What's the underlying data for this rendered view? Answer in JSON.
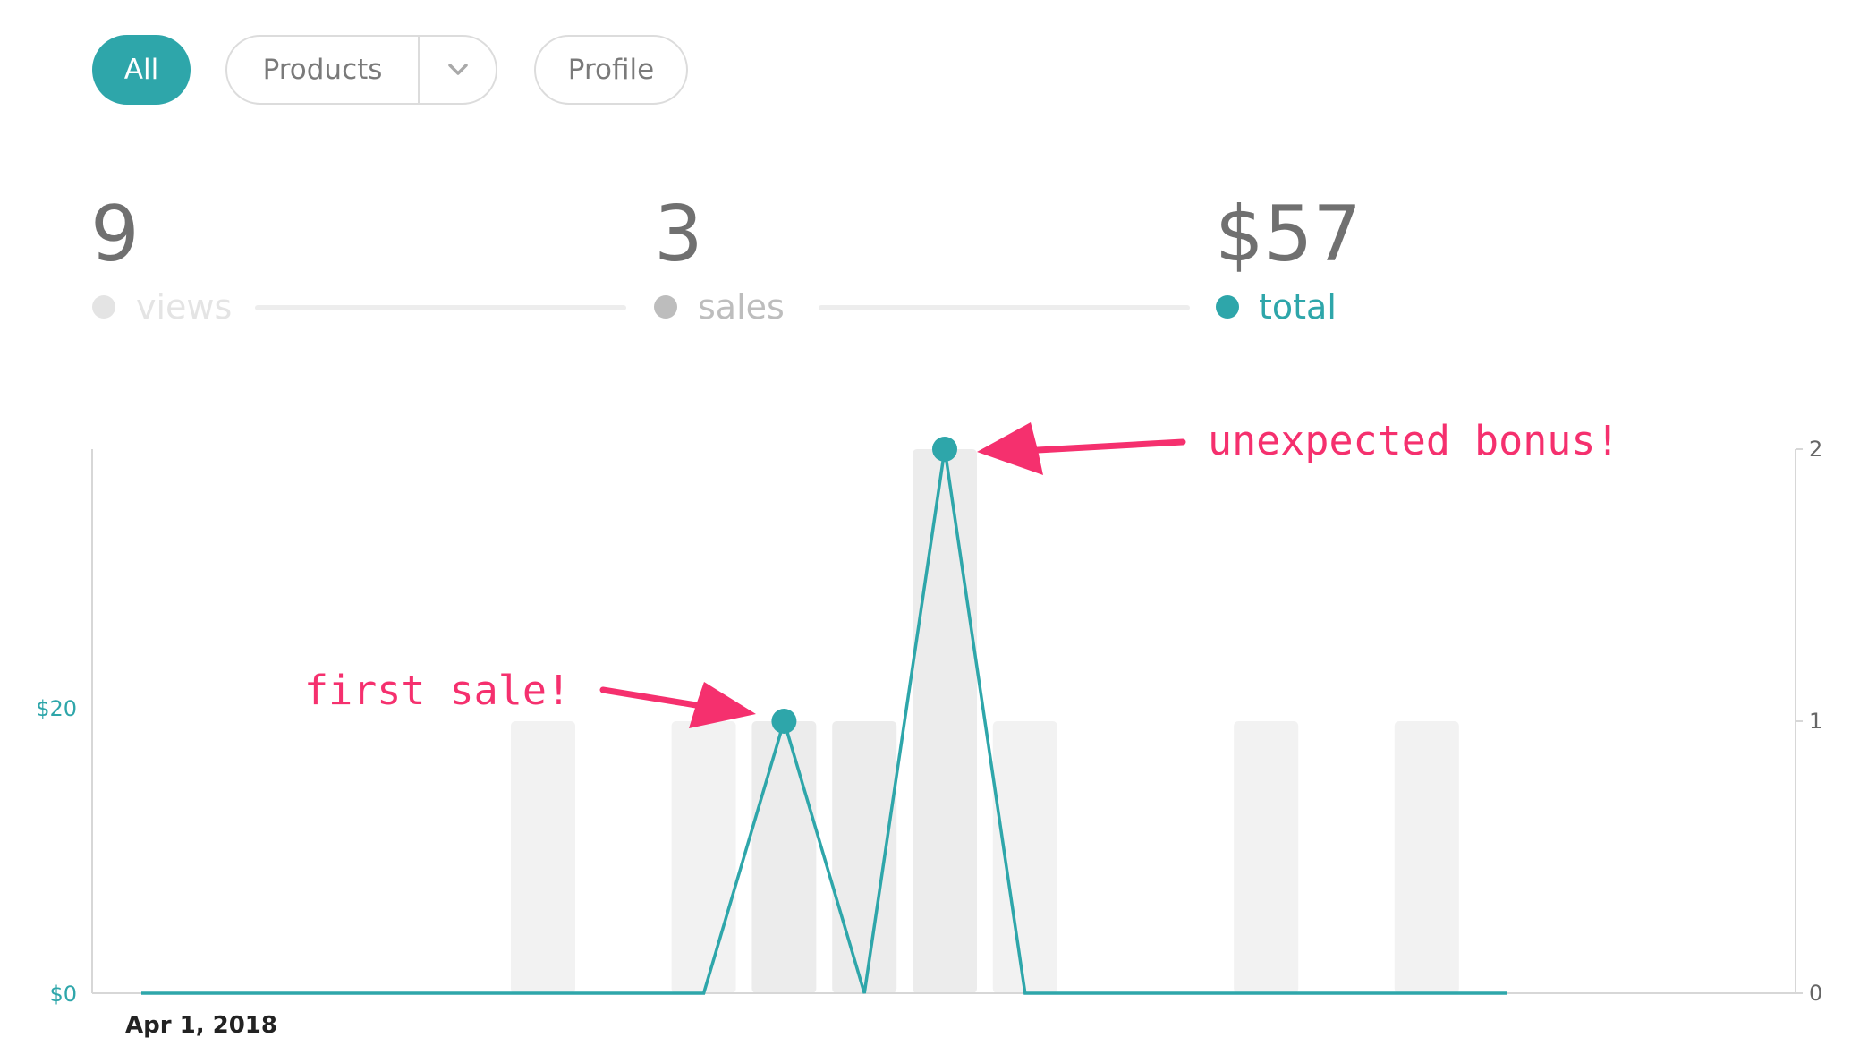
{
  "filters": {
    "all_label": "All",
    "products_label": "Products",
    "profile_label": "Profile"
  },
  "stats": {
    "views": {
      "value": "9",
      "label": "views",
      "color": "#e4e4e4"
    },
    "sales": {
      "value": "3",
      "label": "sales",
      "color": "#bdbdbd"
    },
    "total": {
      "value": "$57",
      "label": "total",
      "color": "#2ea6aa"
    }
  },
  "colors": {
    "accent": "#2ea6aa",
    "annotation": "#f5306e",
    "bar": "#f2f2f2",
    "bar_highlight": "#ececec"
  },
  "annotations": {
    "first_sale": "first sale!",
    "unexpected_bonus": "unexpected bonus!"
  },
  "chart_data": {
    "type": "bar",
    "x_start_label": "Apr 1, 2018",
    "left_axis": {
      "tick_labels": [
        "$0",
        "$20"
      ]
    },
    "right_axis": {
      "tick_labels": [
        "0",
        "1",
        "2"
      ],
      "ylim": [
        0,
        2
      ]
    },
    "series": [
      {
        "name": "sales",
        "kind": "bar",
        "axis": "right",
        "values": [
          0,
          0,
          0,
          0,
          0,
          1,
          0,
          1,
          1,
          1,
          2,
          1,
          0,
          0,
          1,
          0,
          1,
          0,
          0,
          0,
          0
        ]
      },
      {
        "name": "total",
        "kind": "line",
        "axis": "right",
        "values": [
          0,
          0,
          0,
          0,
          0,
          0,
          0,
          0,
          1,
          0,
          2,
          0,
          0,
          0,
          0,
          0,
          0,
          0
        ]
      }
    ]
  }
}
